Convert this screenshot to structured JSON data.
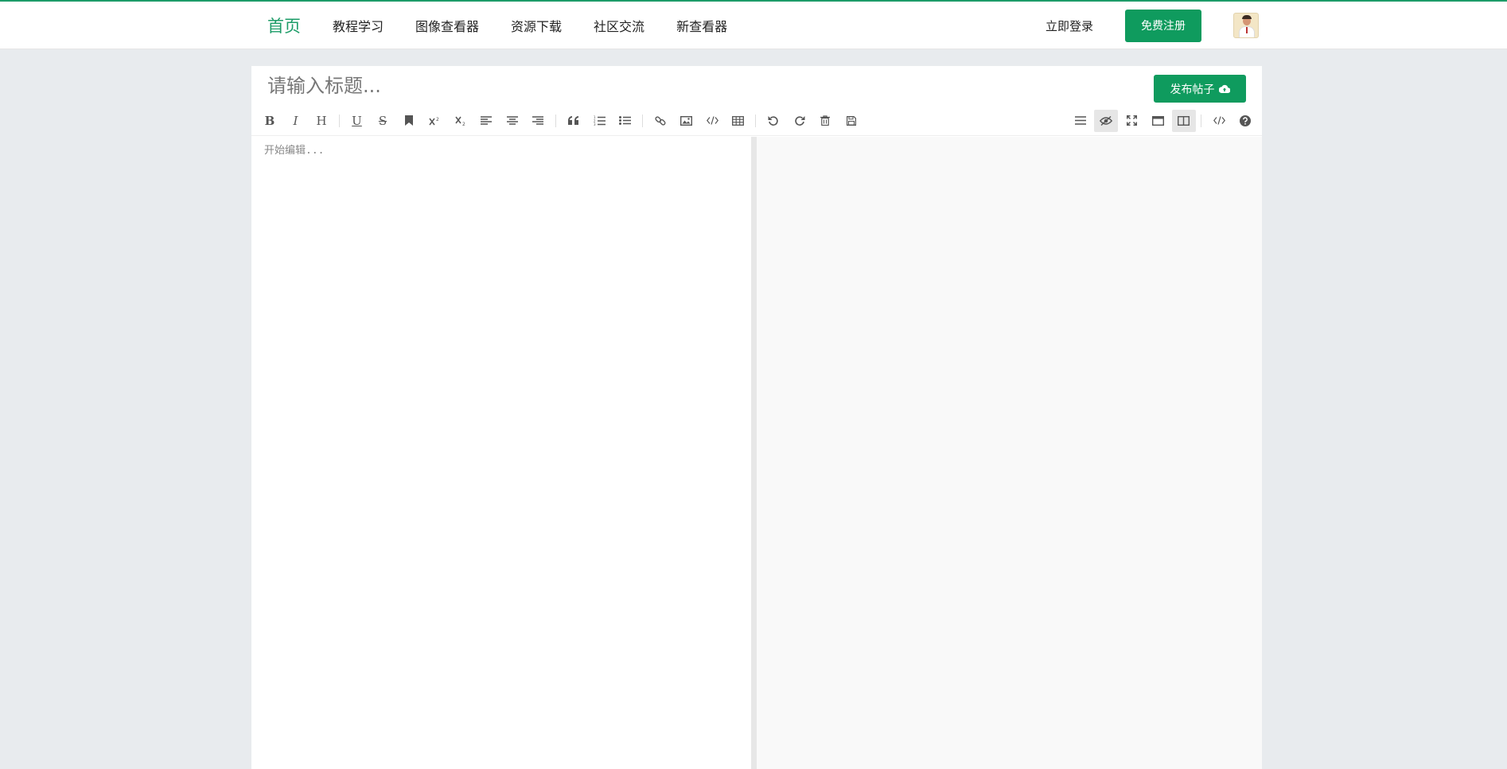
{
  "nav": {
    "links": [
      {
        "label": "首页"
      },
      {
        "label": "教程学习"
      },
      {
        "label": "图像查看器"
      },
      {
        "label": "资源下载"
      },
      {
        "label": "社区交流"
      },
      {
        "label": "新查看器"
      }
    ],
    "login_label": "立即登录",
    "register_label": "免费注册"
  },
  "editor": {
    "title_placeholder": "请输入标题...",
    "publish_label": "发布帖子",
    "body_placeholder": "开始编辑..."
  },
  "colors": {
    "accent": "#1d9c68",
    "button": "#0f9b5e"
  },
  "toolbar": {
    "left_icons": [
      "bold-icon",
      "italic-icon",
      "heading-icon",
      "underline-icon",
      "strikethrough-icon",
      "bookmark-icon",
      "superscript-icon",
      "subscript-icon",
      "align-left-icon",
      "align-center-icon",
      "align-right-icon",
      "blockquote-icon",
      "ordered-list-icon",
      "unordered-list-icon",
      "link-icon",
      "image-icon",
      "code-icon",
      "table-icon",
      "undo-icon",
      "redo-icon",
      "trash-icon",
      "save-icon"
    ],
    "right_icons": [
      "navigation-icon",
      "preview-icon",
      "fullscreen-icon",
      "single-column-icon",
      "two-column-icon",
      "html-code-icon",
      "help-icon"
    ]
  }
}
